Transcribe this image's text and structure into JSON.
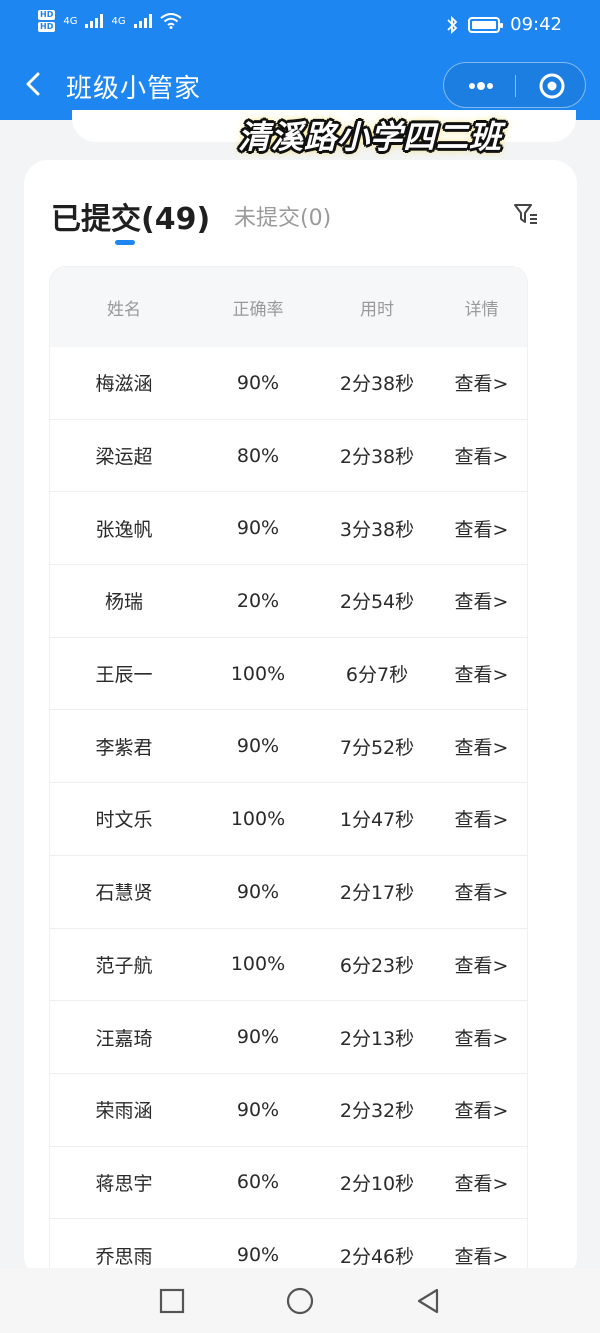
{
  "status_bar": {
    "hd1": "HD",
    "hd2": "HD",
    "net1": "4G",
    "net2": "4G",
    "time": "09:42",
    "icons": [
      "signal-icon",
      "wifi-icon",
      "bluetooth-icon",
      "battery-icon"
    ]
  },
  "header": {
    "title": "班级小管家",
    "icons": [
      "back-arrow-icon",
      "more-dots-icon",
      "target-icon"
    ]
  },
  "overlay_caption": "清溪路小学四二班",
  "tabs": {
    "submitted": "已提交(49)",
    "not_submitted": "未提交(0)"
  },
  "table": {
    "headers": [
      "姓名",
      "正确率",
      "用时",
      "详情"
    ],
    "rows": [
      {
        "name": "梅滋涵",
        "accuracy": "90%",
        "time": "2分38秒",
        "detail": "查看>"
      },
      {
        "name": "梁运超",
        "accuracy": "80%",
        "time": "2分38秒",
        "detail": "查看>"
      },
      {
        "name": "张逸帆",
        "accuracy": "90%",
        "time": "3分38秒",
        "detail": "查看>"
      },
      {
        "name": "杨瑞",
        "accuracy": "20%",
        "time": "2分54秒",
        "detail": "查看>"
      },
      {
        "name": "王辰一",
        "accuracy": "100%",
        "time": "6分7秒",
        "detail": "查看>"
      },
      {
        "name": "李紫君",
        "accuracy": "90%",
        "time": "7分52秒",
        "detail": "查看>"
      },
      {
        "name": "时文乐",
        "accuracy": "100%",
        "time": "1分47秒",
        "detail": "查看>"
      },
      {
        "name": "石慧贤",
        "accuracy": "90%",
        "time": "2分17秒",
        "detail": "查看>"
      },
      {
        "name": "范子航",
        "accuracy": "100%",
        "time": "6分23秒",
        "detail": "查看>"
      },
      {
        "name": "汪嘉琦",
        "accuracy": "90%",
        "time": "2分13秒",
        "detail": "查看>"
      },
      {
        "name": "荣雨涵",
        "accuracy": "90%",
        "time": "2分32秒",
        "detail": "查看>"
      },
      {
        "name": "蒋思宇",
        "accuracy": "60%",
        "time": "2分10秒",
        "detail": "查看>"
      },
      {
        "name": "乔思雨",
        "accuracy": "90%",
        "time": "2分46秒",
        "detail": "查看>"
      }
    ]
  },
  "colors": {
    "brand": "#1e86f0",
    "page_bg": "#f3f4f6"
  }
}
